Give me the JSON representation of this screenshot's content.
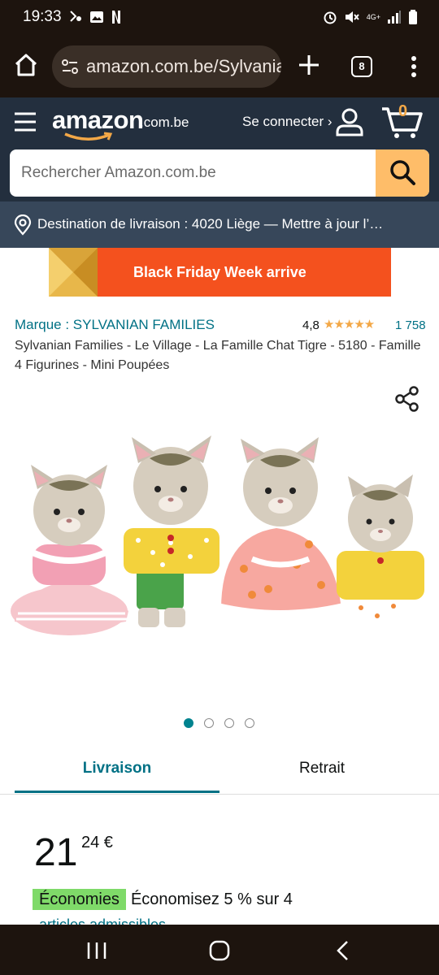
{
  "status_bar": {
    "time": "19:33",
    "left_icons": [
      "vibrate-icon",
      "gallery-icon",
      "netflix-icon"
    ],
    "right_icons": [
      "alarm-icon",
      "mute-icon",
      "lte-icon",
      "signal-icon",
      "battery-icon"
    ],
    "network": "4G+"
  },
  "browser": {
    "url": "amazon.com.be/Sylvanian",
    "tab_count": "8"
  },
  "header": {
    "logo_text": "amazon",
    "logo_suffix": ".com.be",
    "signin_label": "Se connecter ›",
    "cart_count": "0",
    "search_placeholder": "Rechercher Amazon.com.be",
    "delivery": "Destination de livraison : 4020 Liège — Mettre à jour l’…"
  },
  "banner": {
    "text": "Black Friday Week arrive"
  },
  "product": {
    "brand": "Marque : SYLVANIAN FAMILIES",
    "rating": "4,8",
    "rating_value": 4.8,
    "stars": "★★★★★",
    "review_count": "1 758",
    "title": "Sylvanian Families - Le Village - La Famille Chat Tigre - 5180 - Famille 4 Figurines - Mini Poupées",
    "image_count": 4,
    "active_image": 1
  },
  "tabs": [
    "Livraison",
    "Retrait"
  ],
  "price": {
    "whole": "21",
    "fraction": "24 €"
  },
  "savings": {
    "badge": "Économies",
    "text": "Économisez 5 % sur 4",
    "more": "articles admissibles"
  },
  "colors": {
    "amazon_header": "#232f3e",
    "amazon_subheader": "#37475a",
    "search_button": "#febd69",
    "link": "#007185",
    "banner": "#f4511e",
    "savings_badge": "#7fda69"
  }
}
